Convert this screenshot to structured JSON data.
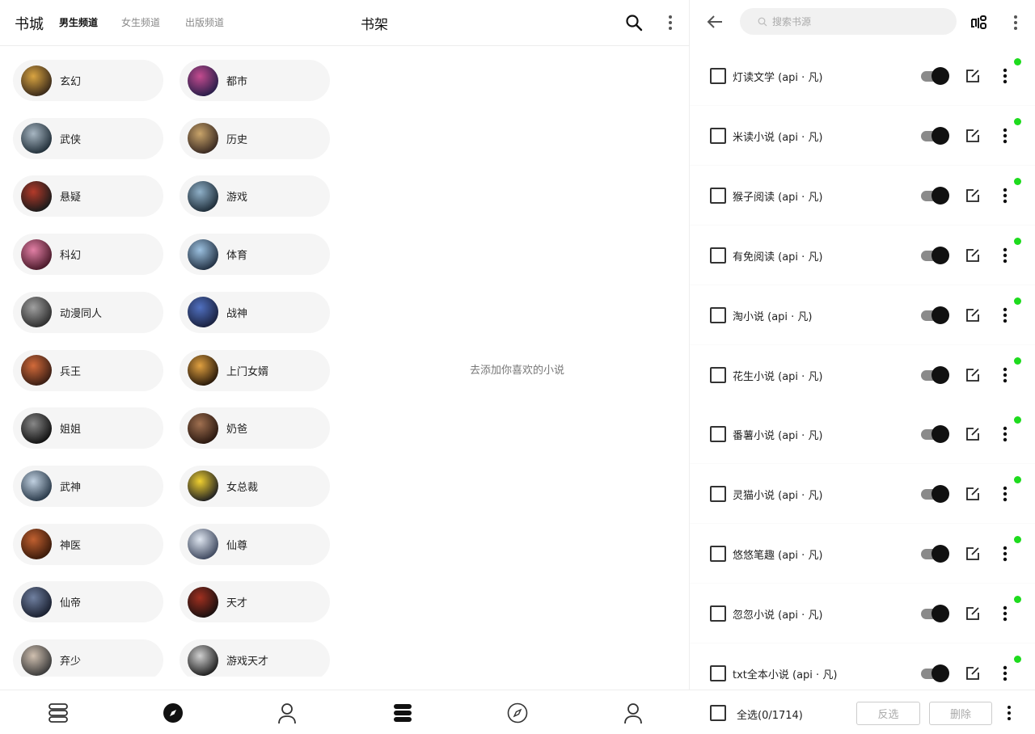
{
  "left": {
    "brand": "书城",
    "tabs": [
      "男生频道",
      "女生频道",
      "出版频道"
    ],
    "shelf_title": "书架",
    "categories": [
      [
        "玄幻",
        "都市"
      ],
      [
        "武侠",
        "历史"
      ],
      [
        "悬疑",
        "游戏"
      ],
      [
        "科幻",
        "体育"
      ],
      [
        "动漫同人",
        "战神"
      ],
      [
        "兵王",
        "上门女婿"
      ],
      [
        "姐姐",
        "奶爸"
      ],
      [
        "武神",
        "女总裁"
      ],
      [
        "神医",
        "仙尊"
      ],
      [
        "仙帝",
        "天才"
      ],
      [
        "弃少",
        "游戏天才"
      ]
    ],
    "empty_text": "去添加你喜欢的小说",
    "nav_icons": [
      "bookshelf-icon",
      "discover-icon",
      "profile-icon",
      "bookshelf-icon",
      "discover-icon",
      "profile-icon"
    ]
  },
  "right": {
    "search_placeholder": "搜索书源",
    "sources": [
      "灯读文学 (api · 凡)",
      "米读小说 (api · 凡)",
      "猴子阅读 (api · 凡)",
      "有免阅读 (api · 凡)",
      "淘小说 (api · 凡)",
      "花生小说 (api · 凡)",
      "番薯小说 (api · 凡)",
      "灵猫小说 (api · 凡)",
      "悠悠笔趣 (api · 凡)",
      "忽忽小说 (api · 凡)",
      "txt全本小说 (api · 凡)"
    ],
    "footer": {
      "select_all": "全选(0/1714)",
      "invert": "反选",
      "delete": "删除"
    },
    "status_color": "#1edb1e"
  }
}
